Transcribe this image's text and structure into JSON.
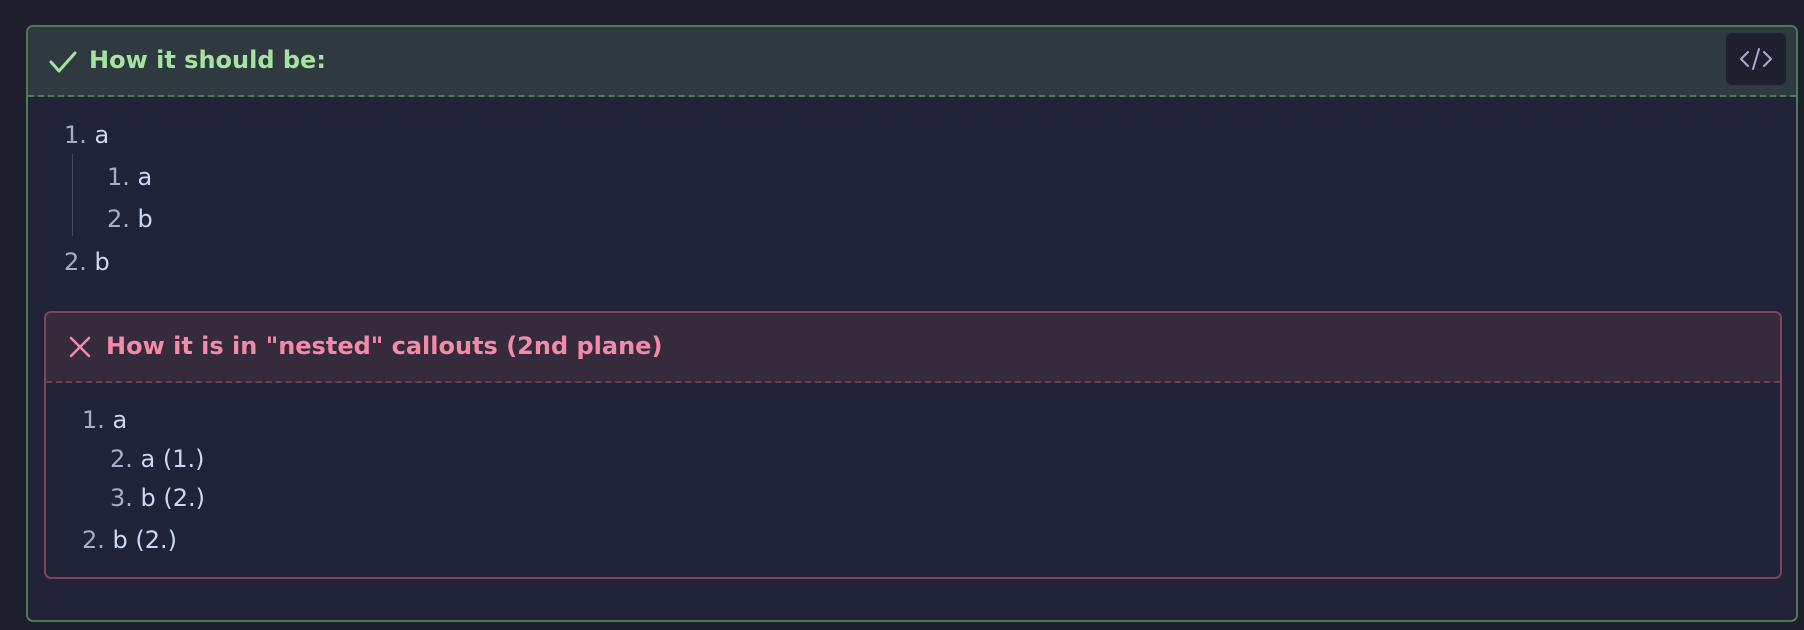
{
  "success_callout": {
    "title": "How it should be:",
    "code_button_icon": "code-icon",
    "items": [
      {
        "num": "1.",
        "text": "a"
      },
      {
        "num": "1.",
        "text": "a"
      },
      {
        "num": "2.",
        "text": "b"
      },
      {
        "num": "2.",
        "text": "b"
      }
    ]
  },
  "fail_callout": {
    "title": "How it is in \"nested\" callouts (2nd plane)",
    "items": [
      {
        "num": "1.",
        "text": "a"
      },
      {
        "num": "2.",
        "text": "a (1.)"
      },
      {
        "num": "3.",
        "text": "b (2.)"
      },
      {
        "num": "2.",
        "text": "b (2.)"
      }
    ]
  },
  "colors": {
    "success_accent": "#a6e3a1",
    "fail_accent": "#f38ba8",
    "background": "#1e1e2e"
  }
}
